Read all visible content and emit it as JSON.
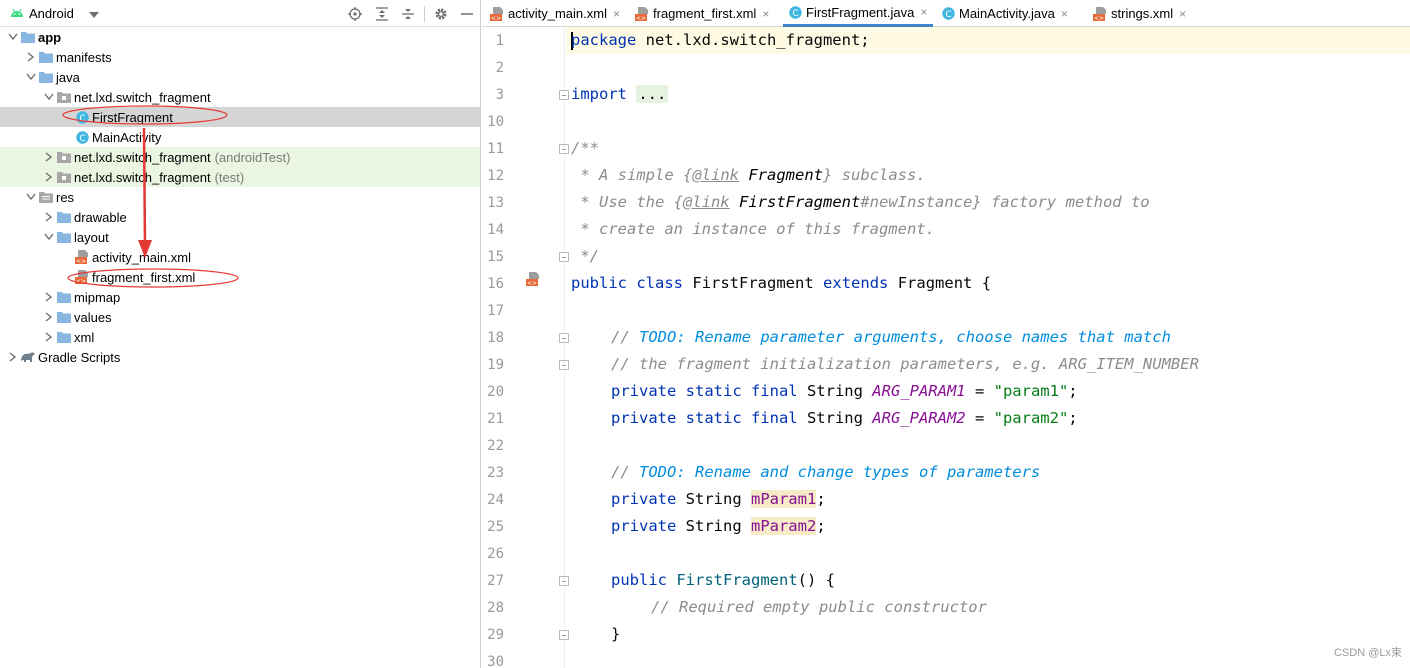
{
  "project_panel": {
    "view_selector": "Android",
    "toolbar_icons": [
      "locate-icon",
      "expand-all-icon",
      "collapse-all-icon",
      "gear-icon",
      "hide-icon"
    ],
    "tree": [
      {
        "label": "app",
        "bold": true,
        "icon": "folder",
        "expanded": true
      },
      {
        "label": "manifests",
        "icon": "folder",
        "expanded": false
      },
      {
        "label": "java",
        "icon": "folder",
        "expanded": true
      },
      {
        "label": "net.lxd.switch_fragment",
        "icon": "package",
        "expanded": true
      },
      {
        "label": "FirstFragment",
        "icon": "class",
        "selected": true
      },
      {
        "label": "MainActivity",
        "icon": "class"
      },
      {
        "label": "net.lxd.switch_fragment",
        "suffix": "(androidTest)",
        "icon": "package",
        "expanded": false,
        "test": true
      },
      {
        "label": "net.lxd.switch_fragment",
        "suffix": "(test)",
        "icon": "package",
        "expanded": false,
        "test": true
      },
      {
        "label": "res",
        "icon": "res-folder",
        "expanded": true
      },
      {
        "label": "drawable",
        "icon": "folder",
        "expanded": false
      },
      {
        "label": "layout",
        "icon": "folder",
        "expanded": true
      },
      {
        "label": "activity_main.xml",
        "icon": "xml"
      },
      {
        "label": "fragment_first.xml",
        "icon": "xml"
      },
      {
        "label": "mipmap",
        "icon": "folder",
        "expanded": false
      },
      {
        "label": "values",
        "icon": "folder",
        "expanded": false
      },
      {
        "label": "xml",
        "icon": "folder",
        "expanded": false
      },
      {
        "label": "Gradle Scripts",
        "icon": "gradle",
        "expanded": false
      }
    ]
  },
  "editor": {
    "tabs": [
      {
        "label": "activity_main.xml",
        "icon": "xml"
      },
      {
        "label": "fragment_first.xml",
        "icon": "xml"
      },
      {
        "label": "FirstFragment.java",
        "icon": "class",
        "active": true
      },
      {
        "label": "MainActivity.java",
        "icon": "class"
      },
      {
        "label": "strings.xml",
        "icon": "xml"
      }
    ],
    "line_numbers": [
      "1",
      "2",
      "3",
      "10",
      "11",
      "12",
      "13",
      "14",
      "15",
      "16",
      "17",
      "18",
      "19",
      "20",
      "21",
      "22",
      "23",
      "24",
      "25",
      "26",
      "27",
      "28",
      "29",
      "30"
    ],
    "code": {
      "l1_kw": "package",
      "l1_rest": " net.lxd.switch_fragment;",
      "l3_kw": "import",
      "l3_dots": "...",
      "l11": "/**",
      "l12_a": " * A simple {",
      "l12_tag": "@link",
      "l12_b": " ",
      "l12_c": "Fragment",
      "l12_d": "} subclass.",
      "l13_a": " * Use the {",
      "l13_tag": "@link",
      "l13_b": " ",
      "l13_c": "FirstFragment",
      "l13_d": "#newInstance} factory method to",
      "l14": " * create an instance of this fragment.",
      "l15": " */",
      "l16_kw1": "public",
      "l16_kw2": "class",
      "l16_name": "FirstFragment",
      "l16_kw3": "extends",
      "l16_rest": "Fragment {",
      "l18_a": "// ",
      "l18_b": "TODO: Rename parameter arguments, choose names that match",
      "l19": "// the fragment initialization parameters, e.g. ARG_ITEM_NUMBER",
      "l20_kw": "private static final",
      "l20_type": " String ",
      "l20_const": "ARG_PARAM1",
      "l20_eq": " = ",
      "l20_str": "\"param1\"",
      "l20_end": ";",
      "l21_kw": "private static final",
      "l21_type": " String ",
      "l21_const": "ARG_PARAM2",
      "l21_eq": " = ",
      "l21_str": "\"param2\"",
      "l21_end": ";",
      "l23_a": "// ",
      "l23_b": "TODO: Rename and change types of parameters",
      "l24_kw": "private",
      "l24_type": " String ",
      "l24_fld": "mParam1",
      "l24_end": ";",
      "l25_kw": "private",
      "l25_type": " String ",
      "l25_fld": "mParam2",
      "l25_end": ";",
      "l27_kw": "public",
      "l27_name": "FirstFragment",
      "l27_rest": "() {",
      "l28": "// Required empty public constructor",
      "l29": "}"
    }
  },
  "watermark": "CSDN @Lx束",
  "colors": {
    "keyword": "#0033b3",
    "comment": "#8c8c8c",
    "todo": "#008dde",
    "string": "#067d17",
    "constant": "#871094",
    "annotation": "#e53935"
  }
}
